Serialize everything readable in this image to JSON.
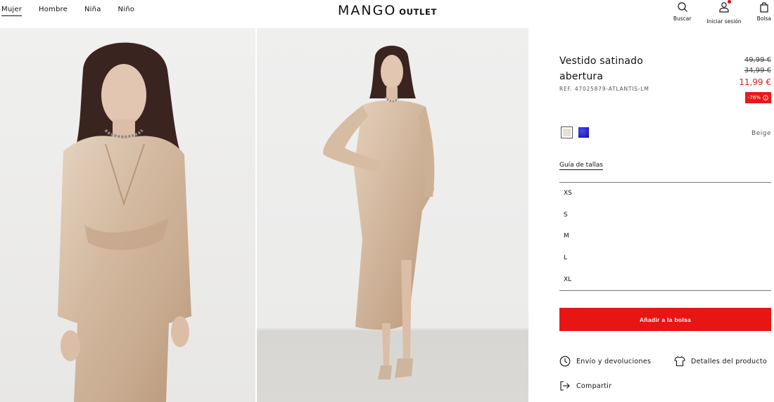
{
  "nav": {
    "items": [
      "Mujer",
      "Hombre",
      "Niña",
      "Niño"
    ]
  },
  "logo": {
    "brand": "MANGO",
    "sub": "OUTLET"
  },
  "tools": {
    "search": "Buscar",
    "login": "Iniciar sesión",
    "bag": "Bolsa"
  },
  "product": {
    "title": "Vestido satinado abertura",
    "ref": "REF. 47025879-ATLANTIS-LM",
    "price_old1": "49,99 €",
    "price_old2": "34,99 €",
    "price_now": "11,99 €",
    "discount": "-76%",
    "color_name": "Beige",
    "colors": [
      "#e5dfd4",
      "#1c1cbf"
    ],
    "size_guide": "Guía de tallas",
    "sizes": [
      "XS",
      "S",
      "M",
      "L",
      "XL"
    ],
    "add_to_bag": "Añadir a la bolsa",
    "shipping": "Envío y devoluciones",
    "details": "Detalles del producto",
    "share": "Compartir"
  },
  "colors": {
    "accent": "#e81515",
    "sale": "#e31b1b"
  }
}
